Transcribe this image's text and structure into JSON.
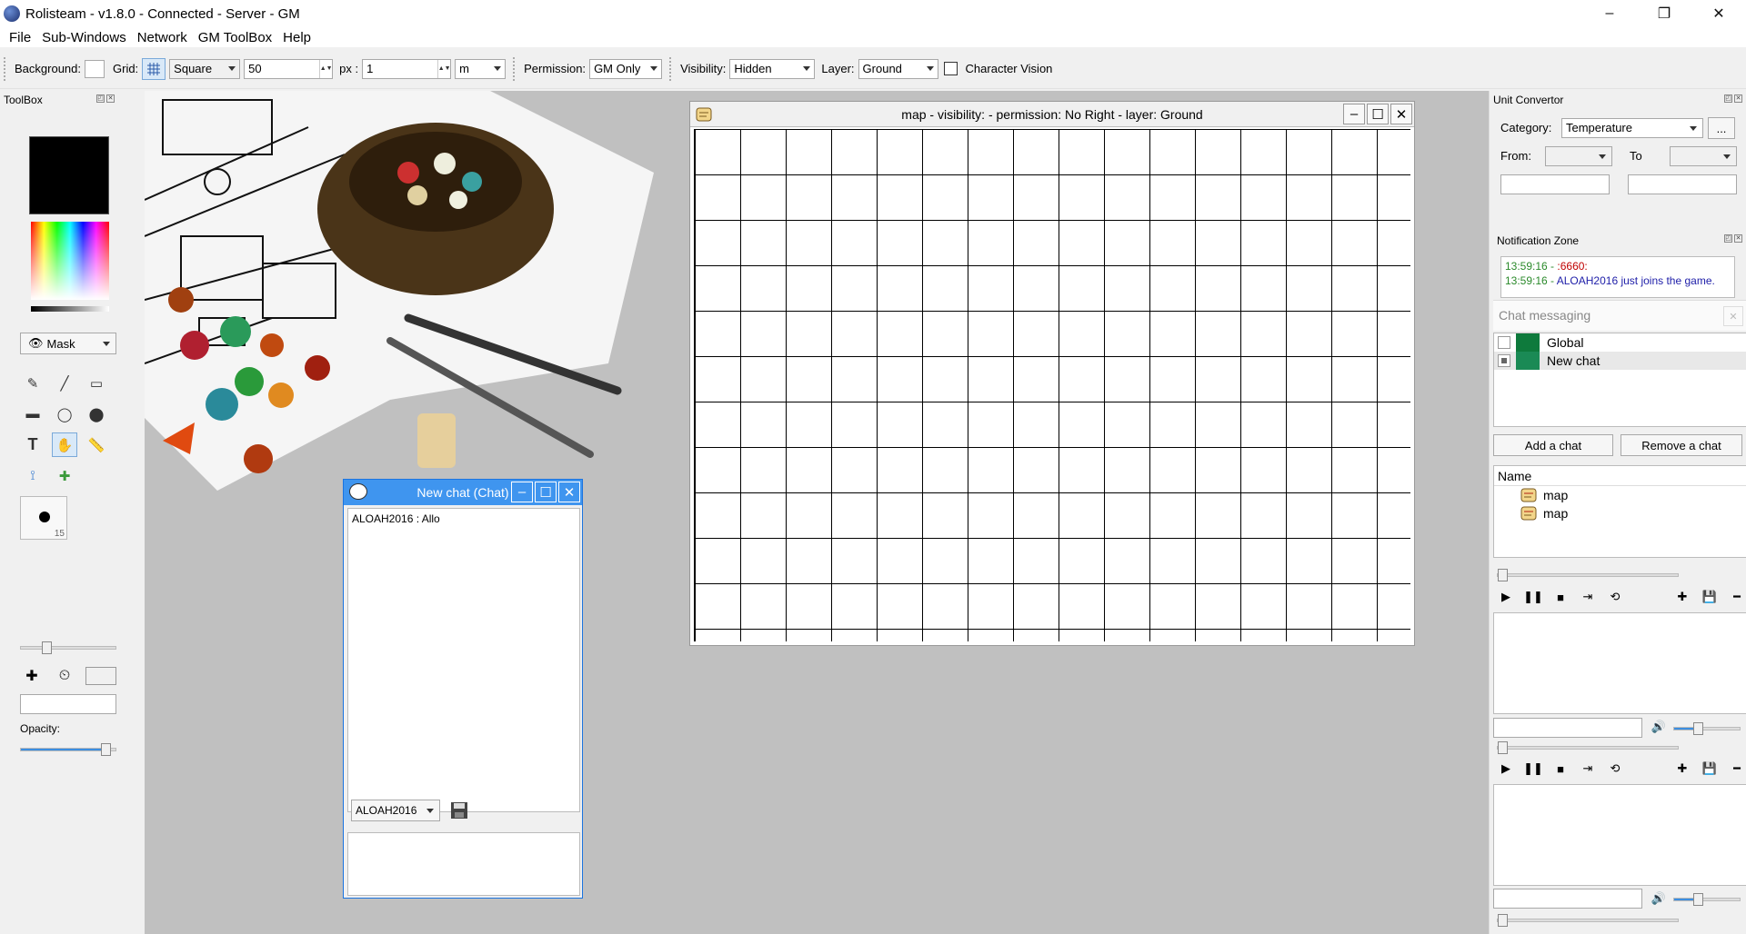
{
  "window": {
    "title": "Rolisteam - v1.8.0 - Connected - Server - GM",
    "minimize": "–",
    "maximize": "❐",
    "close": "✕"
  },
  "menu": [
    "File",
    "Sub-Windows",
    "Network",
    "GM ToolBox",
    "Help"
  ],
  "toolbar": {
    "background_label": "Background:",
    "grid_label": "Grid:",
    "grid_shape": "Square",
    "grid_size": "50",
    "px_label": "px :",
    "scale_value": "1",
    "unit": "m",
    "permission_label": "Permission:",
    "permission_value": "GM Only",
    "visibility_label": "Visibility:",
    "visibility_value": "Hidden",
    "layer_label": "Layer:",
    "layer_value": "Ground",
    "character_vision_label": "Character Vision"
  },
  "toolbox": {
    "title": "ToolBox",
    "mode": "Mask",
    "pen_size": "15",
    "opacity_label": "Opacity:",
    "opacity_value": 0.95,
    "pen_slider_value": 0.25
  },
  "map_window": {
    "title": "map - visibility:  - permission: No Right - layer: Ground",
    "minimize": "–",
    "maximize": "☐",
    "close": "✕"
  },
  "chat_window": {
    "title": "New chat (Chat)",
    "minimize": "–",
    "maximize": "☐",
    "close": "✕",
    "messages": [
      "ALOAH2016 : Allo"
    ],
    "user": "ALOAH2016"
  },
  "unit_convertor": {
    "title": "Unit Convertor",
    "category_label": "Category:",
    "category_value": "Temperature",
    "more_button": "...",
    "from_label": "From:",
    "to_label": "To"
  },
  "notification_zone": {
    "title": "Notification Zone",
    "lines": [
      {
        "time": "13:59:16",
        "sep": " - ",
        "text": ":6660:",
        "color": "red"
      },
      {
        "time": "13:59:16",
        "sep": " - ",
        "text": "ALOAH2016 just joins the game.",
        "color": "blue"
      }
    ]
  },
  "chat_messaging": {
    "title": "Chat messaging",
    "chats": [
      {
        "name": "Global",
        "checked": false,
        "color": "#0e7a3c"
      },
      {
        "name": "New chat",
        "checked": true,
        "color": "#1a8a55"
      }
    ],
    "add_button": "Add a chat",
    "remove_button": "Remove a chat"
  },
  "media_list": {
    "header": "Name",
    "items": [
      "map",
      "map"
    ]
  },
  "players": [
    {
      "volume": 0.35
    },
    {
      "volume": 0.35
    }
  ]
}
